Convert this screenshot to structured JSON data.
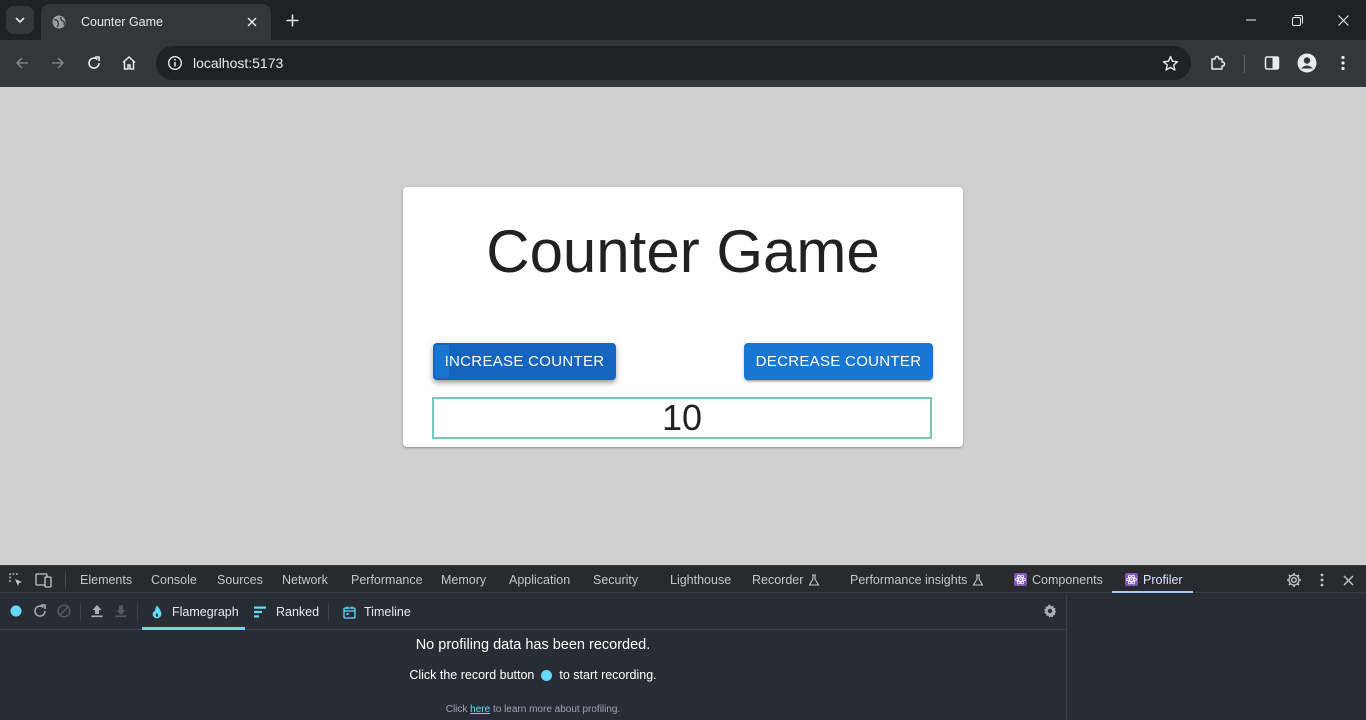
{
  "browser": {
    "tab_title": "Counter Game",
    "url": "localhost:5173"
  },
  "page": {
    "title": "Counter Game",
    "increase_label": "INCREASE COUNTER",
    "decrease_label": "DECREASE COUNTER",
    "counter_value": "10"
  },
  "devtools": {
    "tabs": [
      "Elements",
      "Console",
      "Sources",
      "Network",
      "Performance",
      "Memory",
      "Application",
      "Security",
      "Lighthouse",
      "Recorder",
      "Performance insights",
      "Components",
      "Profiler"
    ],
    "active_tab": "Profiler",
    "profiler": {
      "tabs": [
        "Flamegraph",
        "Ranked",
        "Timeline"
      ],
      "active_tab": "Flamegraph",
      "empty_title": "No profiling data has been recorded.",
      "hint_before": "Click the record button",
      "hint_after": "to start recording.",
      "learn_prefix": "Click",
      "learn_link": "here",
      "learn_suffix": "to learn more about profiling."
    }
  },
  "colors": {
    "button_primary": "#1976d2",
    "react_accent": "#61dafb",
    "page_background": "#d0d0d0",
    "input_border": "#77c7bd"
  }
}
